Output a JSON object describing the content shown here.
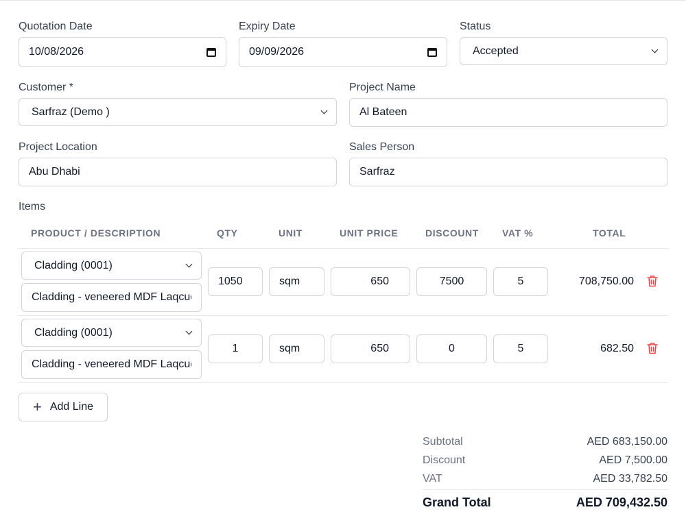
{
  "header": {
    "quotation_date_label": "Quotation Date",
    "quotation_date_value": "10/08/2026",
    "expiry_date_label": "Expiry Date",
    "expiry_date_value": "09/09/2026",
    "status_label": "Status",
    "status_value": "Accepted"
  },
  "customer": {
    "customer_label": "Customer *",
    "customer_value": "Sarfraz (Demo )",
    "project_name_label": "Project Name",
    "project_name_value": "Al Bateen",
    "project_location_label": "Project Location",
    "project_location_value": "Abu Dhabi",
    "sales_person_label": "Sales Person",
    "sales_person_value": "Sarfraz"
  },
  "items": {
    "section_label": "Items",
    "columns": [
      "PRODUCT / DESCRIPTION",
      "QTY",
      "UNIT",
      "UNIT PRICE",
      "DISCOUNT",
      "VAT %",
      "TOTAL"
    ],
    "rows": [
      {
        "product": "Cladding (0001)",
        "description": "Cladding - veneered MDF Laqcuer",
        "qty": "1050",
        "unit": "sqm",
        "unit_price": "650",
        "discount": "7500",
        "vat": "5",
        "total": "708,750.00"
      },
      {
        "product": "Cladding (0001)",
        "description": "Cladding - veneered MDF Laqcuer",
        "qty": "1",
        "unit": "sqm",
        "unit_price": "650",
        "discount": "0",
        "vat": "5",
        "total": "682.50"
      }
    ],
    "add_line_label": "Add Line"
  },
  "summary": {
    "subtotal_label": "Subtotal",
    "subtotal_value": "AED 683,150.00",
    "discount_label": "Discount",
    "discount_value": "AED 7,500.00",
    "vat_label": "VAT",
    "vat_value": "AED 33,782.50",
    "grand_total_label": "Grand Total",
    "grand_total_value": "AED 709,432.50"
  },
  "colors": {
    "danger": "#ef4444",
    "border": "#d1d5db",
    "muted": "#6b7280"
  }
}
